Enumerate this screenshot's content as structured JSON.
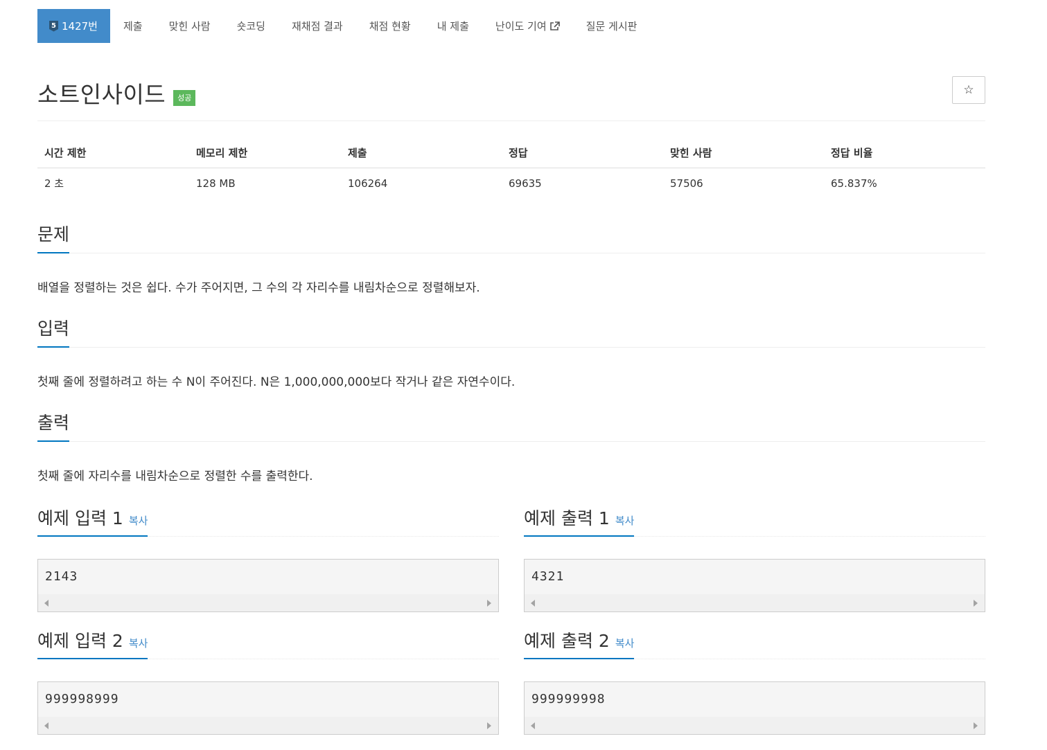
{
  "tabs": {
    "problem": {
      "tier": "5",
      "label": "1427번"
    },
    "items": [
      "제출",
      "맞힌 사람",
      "숏코딩",
      "재채점 결과",
      "채점 현황",
      "내 제출",
      "난이도 기여",
      "질문 게시판"
    ]
  },
  "title": "소트인사이드",
  "status_badge": "성공",
  "info_table": {
    "headers": [
      "시간 제한",
      "메모리 제한",
      "제출",
      "정답",
      "맞힌 사람",
      "정답 비율"
    ],
    "values": [
      "2 초",
      "128 MB",
      "106264",
      "69635",
      "57506",
      "65.837%"
    ]
  },
  "sections": {
    "problem": {
      "heading": "문제",
      "text": "배열을 정렬하는 것은 쉽다. 수가 주어지면, 그 수의 각 자리수를 내림차순으로 정렬해보자."
    },
    "input": {
      "heading": "입력",
      "text": "첫째 줄에 정렬하려고 하는 수 N이 주어진다. N은 1,000,000,000보다 작거나 같은 자연수이다."
    },
    "output": {
      "heading": "출력",
      "text": "첫째 줄에 자리수를 내림차순으로 정렬한 수를 출력한다."
    }
  },
  "samples": [
    {
      "title": "예제 입력 1",
      "copy": "복사",
      "data": "2143"
    },
    {
      "title": "예제 출력 1",
      "copy": "복사",
      "data": "4321"
    },
    {
      "title": "예제 입력 2",
      "copy": "복사",
      "data": "999998999"
    },
    {
      "title": "예제 출력 2",
      "copy": "복사",
      "data": "999999998"
    }
  ],
  "colors": {
    "accent": "#428bca",
    "underline": "#0076c0",
    "success": "#5cb85c"
  },
  "icons": {
    "star": "star-outline-icon",
    "external": "external-link-icon",
    "tier": "bronze-tier-icon"
  }
}
